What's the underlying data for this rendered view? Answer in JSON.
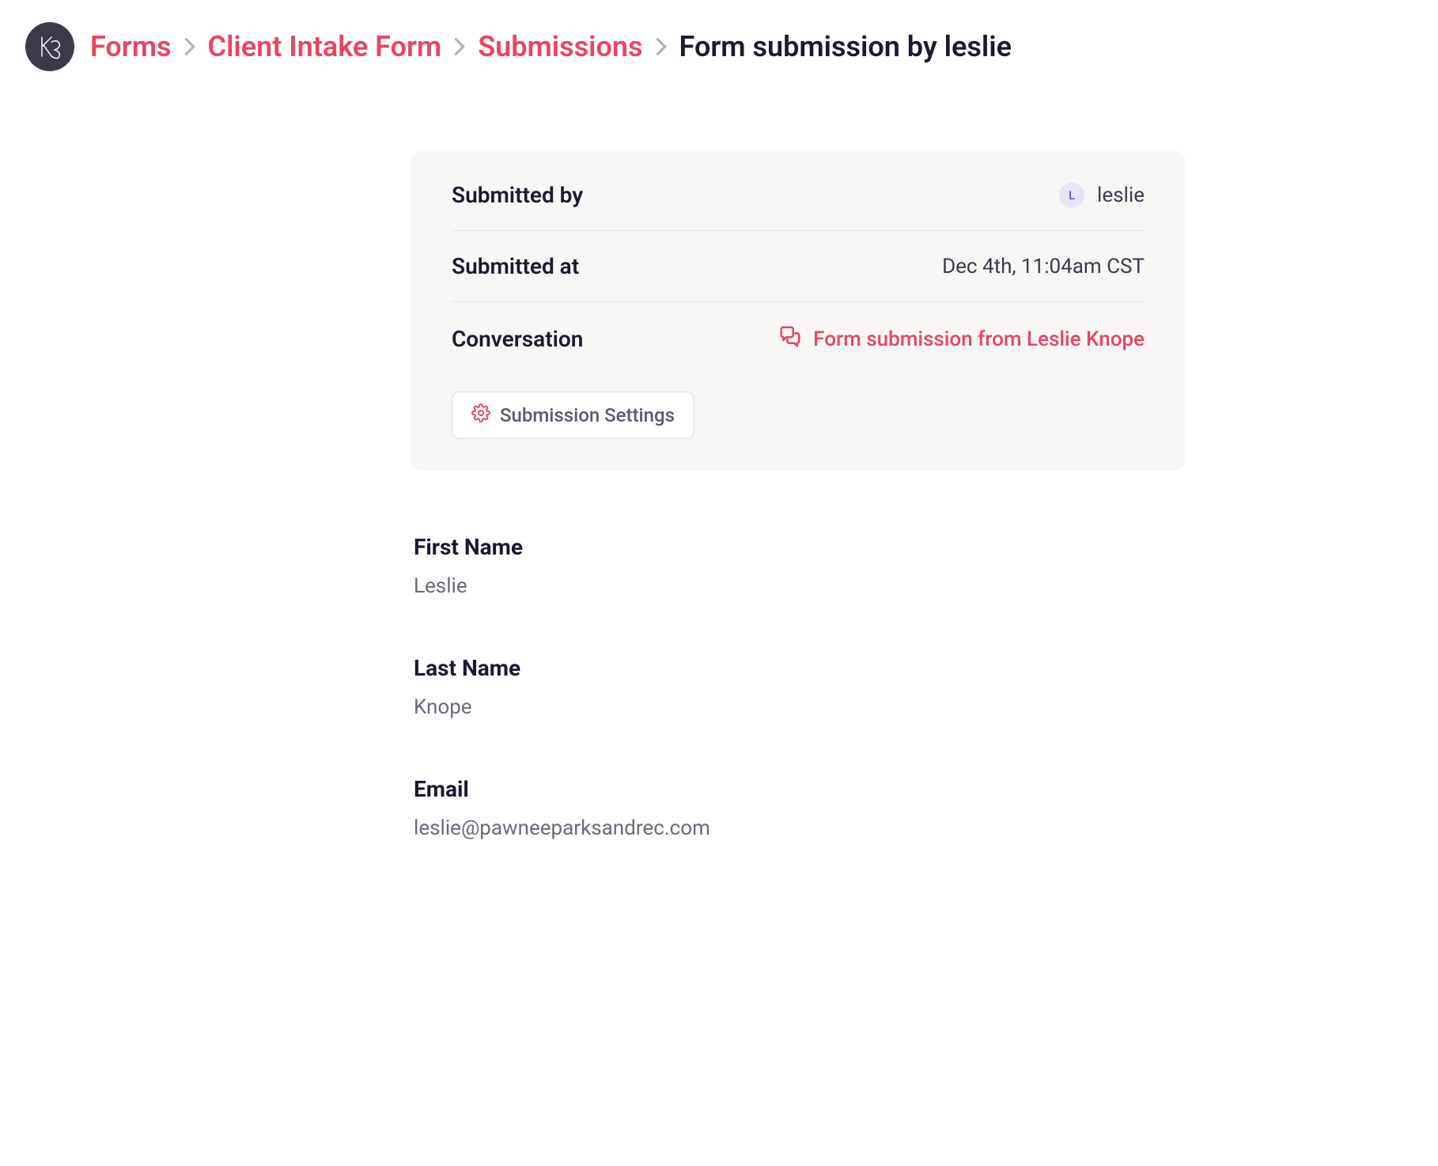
{
  "breadcrumb": {
    "items": [
      {
        "label": "Forms"
      },
      {
        "label": "Client Intake Form"
      },
      {
        "label": "Submissions"
      }
    ],
    "current": "Form submission by leslie"
  },
  "summary": {
    "submitted_by_label": "Submitted by",
    "submitted_by_user": "leslie",
    "submitted_by_avatar_initial": "L",
    "submitted_at_label": "Submitted at",
    "submitted_at_value": "Dec 4th, 11:04am CST",
    "conversation_label": "Conversation",
    "conversation_link_text": "Form submission from Leslie Knope",
    "settings_button_label": "Submission Settings"
  },
  "fields": [
    {
      "label": "First Name",
      "value": "Leslie"
    },
    {
      "label": "Last Name",
      "value": "Knope"
    },
    {
      "label": "Email",
      "value": "leslie@pawneeparksandrec.com"
    }
  ]
}
